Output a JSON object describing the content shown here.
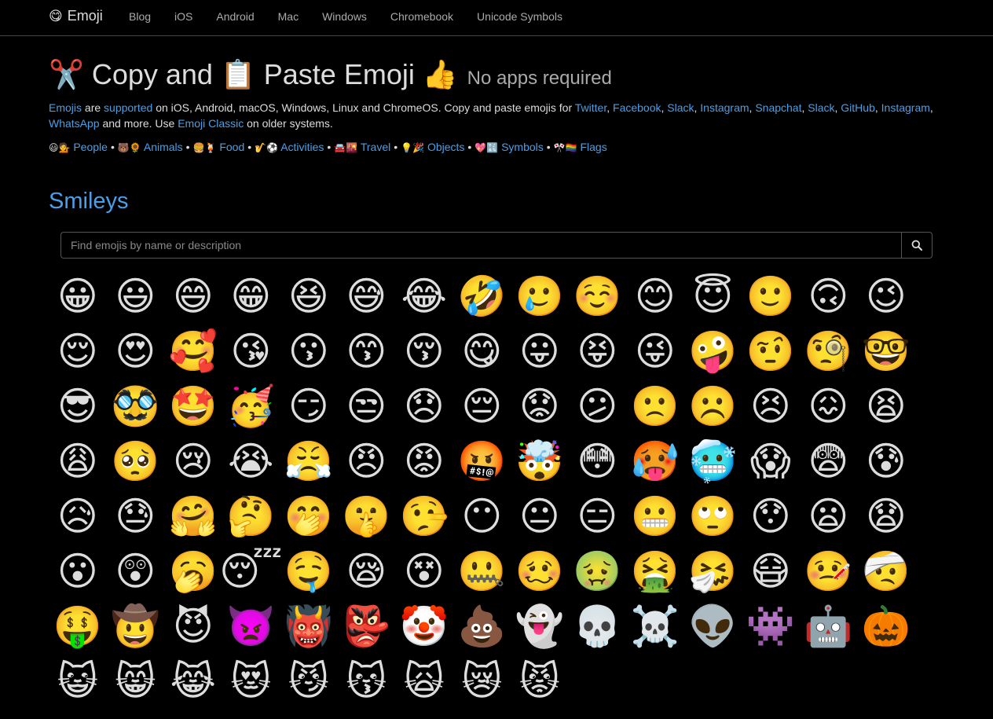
{
  "nav": {
    "brand_icon": "😋",
    "brand": "Emoji",
    "links": [
      "Blog",
      "iOS",
      "Android",
      "Mac",
      "Windows",
      "Chromebook",
      "Unicode Symbols"
    ]
  },
  "hero": {
    "title": "✂️ Copy and 📋 Paste Emoji 👍",
    "subtitle": "No apps required"
  },
  "intro": {
    "parts": [
      {
        "text": "Emojis",
        "link": true
      },
      {
        "text": " are ",
        "link": false
      },
      {
        "text": "supported",
        "link": true
      },
      {
        "text": " on iOS, Android, macOS, Windows, Linux and ChromeOS. Copy and paste emojis for ",
        "link": false
      },
      {
        "text": "Twitter",
        "link": true
      },
      {
        "text": ", ",
        "link": false
      },
      {
        "text": "Facebook",
        "link": true
      },
      {
        "text": ", ",
        "link": false
      },
      {
        "text": "Slack",
        "link": true
      },
      {
        "text": ", ",
        "link": false
      },
      {
        "text": "Instagram",
        "link": true
      },
      {
        "text": ", ",
        "link": false
      },
      {
        "text": "Snapchat",
        "link": true
      },
      {
        "text": ", ",
        "link": false
      },
      {
        "text": "Slack",
        "link": true
      },
      {
        "text": ", ",
        "link": false
      },
      {
        "text": "GitHub",
        "link": true
      },
      {
        "text": ", ",
        "link": false
      },
      {
        "text": "Instagram",
        "link": true
      },
      {
        "text": ", ",
        "link": false
      },
      {
        "text": "WhatsApp",
        "link": true
      },
      {
        "text": " and more. Use ",
        "link": false
      },
      {
        "text": "Emoji Classic",
        "link": true
      },
      {
        "text": " on older systems.",
        "link": false
      }
    ]
  },
  "categories": [
    {
      "icons": "😃💁",
      "label": "People"
    },
    {
      "icons": "🐻🌻",
      "label": "Animals"
    },
    {
      "icons": "🍔🍹",
      "label": "Food"
    },
    {
      "icons": "🎷⚽️",
      "label": "Activities"
    },
    {
      "icons": "🚘🌇",
      "label": "Travel"
    },
    {
      "icons": "💡🎉",
      "label": "Objects"
    },
    {
      "icons": "💖🔣",
      "label": "Symbols"
    },
    {
      "icons": "🎌🏳️‍🌈",
      "label": "Flags"
    }
  ],
  "category_separator": "•",
  "section": {
    "title": "Smileys"
  },
  "search": {
    "placeholder": "Find emojis by name or description",
    "value": "",
    "button_icon": "search-icon"
  },
  "emojis": [
    "😀",
    "😃",
    "😄",
    "😁",
    "😆",
    "😅",
    "😂",
    "🤣",
    "🥲",
    "☺️",
    "😊",
    "😇",
    "🙂",
    "🙃",
    "😉",
    "😌",
    "😍",
    "🥰",
    "😘",
    "😗",
    "😙",
    "😚",
    "😋",
    "😛",
    "😝",
    "😜",
    "🤪",
    "🤨",
    "🧐",
    "🤓",
    "😎",
    "🥸",
    "🤩",
    "🥳",
    "😏",
    "😒",
    "😞",
    "😔",
    "😟",
    "😕",
    "🙁",
    "☹️",
    "😣",
    "😖",
    "😫",
    "😩",
    "🥺",
    "😢",
    "😭",
    "😤",
    "😠",
    "😡",
    "🤬",
    "🤯",
    "😳",
    "🥵",
    "🥶",
    "😱",
    "😨",
    "😰",
    "😥",
    "😓",
    "🤗",
    "🤔",
    "🤭",
    "🤫",
    "🤥",
    "😶",
    "😐",
    "😑",
    "😬",
    "🙄",
    "😯",
    "😦",
    "😧",
    "😮",
    "😲",
    "🥱",
    "😴",
    "🤤",
    "😪",
    "😵",
    "🤐",
    "🥴",
    "🤢",
    "🤮",
    "🤧",
    "😷",
    "🤒",
    "🤕",
    "🤑",
    "🤠",
    "😈",
    "👿",
    "👹",
    "👺",
    "🤡",
    "💩",
    "👻",
    "💀",
    "☠️",
    "👽",
    "👾",
    "🤖",
    "🎃",
    "😺",
    "😸",
    "😹",
    "😻",
    "😼",
    "😽",
    "🙀",
    "😿",
    "😾"
  ]
}
